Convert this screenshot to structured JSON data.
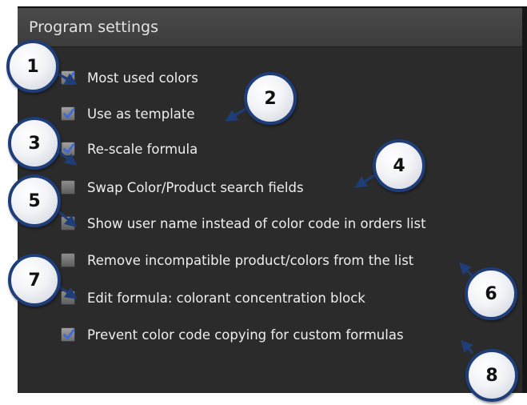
{
  "panel": {
    "title": "Program settings"
  },
  "settings": [
    {
      "label": "Most used colors",
      "checked": true
    },
    {
      "label": "Use as template",
      "checked": true
    },
    {
      "label": "Re-scale formula",
      "checked": true
    },
    {
      "label": "Swap Color/Product search fields",
      "checked": false
    },
    {
      "label": "Show user name instead of color code in orders list",
      "checked": false
    },
    {
      "label": "Remove incompatible product/colors from the list",
      "checked": false
    },
    {
      "label": "Edit formula: colorant concentration block",
      "checked": false
    },
    {
      "label": "Prevent color code copying for custom formulas",
      "checked": true
    }
  ],
  "callouts": [
    "1",
    "2",
    "3",
    "4",
    "5",
    "6",
    "7",
    "8"
  ],
  "colors": {
    "panel_bg": "#2b2b2b",
    "header_bg": "#424242",
    "checkmark": "#3f6bd6",
    "callout_border": "#1f3d78"
  }
}
